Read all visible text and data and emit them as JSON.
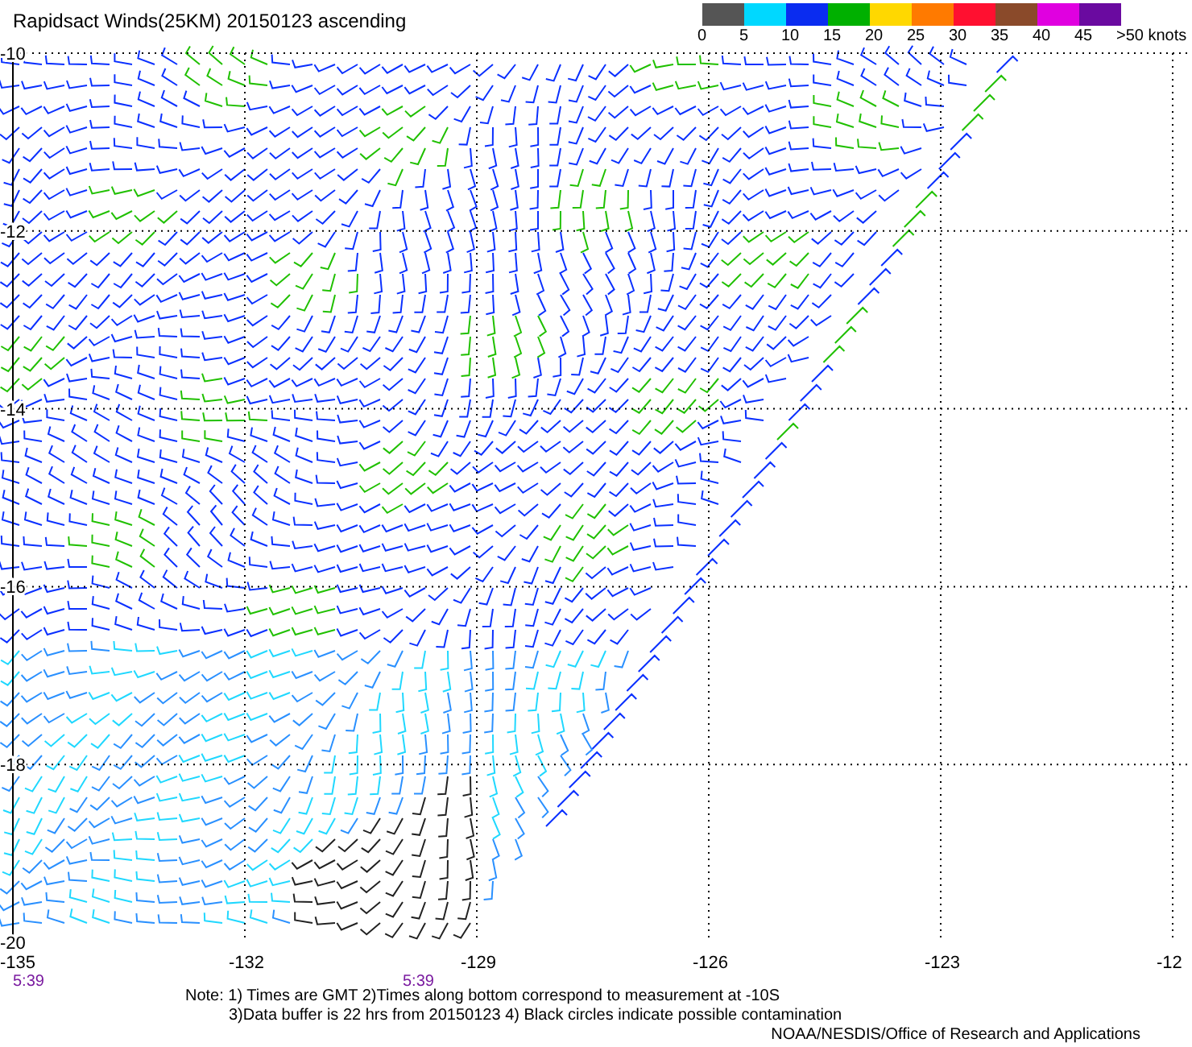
{
  "title": "Rapidsact Winds(25KM) 20150123 ascending",
  "legend": {
    "segments": [
      {
        "color": "#555555"
      },
      {
        "color": "#00d8ff"
      },
      {
        "color": "#0a2cf0"
      },
      {
        "color": "#00b000"
      },
      {
        "color": "#ffd800"
      },
      {
        "color": "#ff7a00"
      },
      {
        "color": "#ff1030"
      },
      {
        "color": "#8a4a2a"
      },
      {
        "color": "#e000e0"
      },
      {
        "color": "#6a0aa0"
      }
    ],
    "labels": [
      "0",
      "5",
      "10",
      "15",
      "20",
      "25",
      "30",
      "35",
      "40",
      "45",
      ">50 knots"
    ]
  },
  "map": {
    "y_labels": [
      "-10",
      "-12",
      "-14",
      "-16",
      "-18",
      "-20"
    ],
    "x_labels": [
      "-135",
      "-132",
      "-129",
      "-126",
      "-123",
      "-12"
    ],
    "time_labels": [
      "5:39",
      "5:39"
    ]
  },
  "notes": [
    "Note: 1) Times are GMT 2)Times along bottom correspond to measurement at -10S",
    "3)Data buffer is 22 hrs from 20150123 4) Black circles indicate possible contamination"
  ],
  "credit": "NOAA/NESDIS/Office of Research and Applications"
}
